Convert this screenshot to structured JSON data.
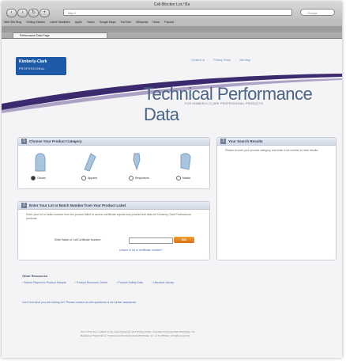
{
  "window": {
    "title": "Cell-Blocker Lot / Ba",
    "url": "http://",
    "search_placeholder": "Google"
  },
  "bookmarks": [
    "Web Site Blog",
    "Getting Started",
    "Latest Headlines",
    "Apple",
    "Yahoo",
    "Google Maps",
    "YouTube",
    "Wikipedia",
    "News",
    "Popular"
  ],
  "tabs": [
    "Google",
    "Consumer",
    "Web",
    "Sales",
    "Images",
    "Documents",
    "Maps",
    "Kimberly-Clark"
  ],
  "active_tab": "Performance Data Page",
  "page": {
    "logo_top": "Kimberly-Clark",
    "logo_bottom": "PROFESSIONAL",
    "top_links": [
      "Contact Us",
      "Privacy Policy",
      "Site Map"
    ],
    "title": "Technical Performance Data",
    "subtitle": "FOR KIMBERLY-CLARK PROFESSIONAL PRODUCTS",
    "panels": {
      "category": {
        "number": "1",
        "title": "Choose Your Product Category",
        "options": [
          "Gloves",
          "Apparel",
          "Respirators",
          "Masks"
        ],
        "selected_index": 0
      },
      "lot": {
        "number": "2",
        "title": "Enter Your Lot or Batch Number from Your Product Label",
        "description": "Enter your lot or batch number from the product label to access certificate reports and product test data for Kimberly-Clark Professional products.",
        "input_label": "Enter Batch or Lot/Certificate Number:",
        "input_value": "",
        "go_label": "GO",
        "unsure_link": "Unsure of lot or certificate number?"
      },
      "results": {
        "number": "3",
        "title": "Your Search Results",
        "text": "Please choose your product category and enter a lot number to view results."
      }
    },
    "resources": {
      "title": "Other Resources",
      "links": [
        "Search Report for Product Sample",
        "Product Resource Center",
        "Product Safety Data",
        "Literature Library"
      ]
    },
    "notice": "Can't find what you are looking for? Please contact us with questions or for further assistance.",
    "legal": [
      "Use of this site is subject to the Legal Statement and Privacy Policy. Copyright Kimberly-Clark Worldwide, Inc.",
      "Registered Trademark or Trademark of Kimberly-Clark Worldwide, Inc. or its affiliates. All rights reserved."
    ]
  },
  "colors": {
    "brand_blue": "#1f5aa6",
    "title_slate": "#4a6384",
    "swoosh_purple": "#3b2a6e",
    "go_orange": "#e08a24"
  }
}
